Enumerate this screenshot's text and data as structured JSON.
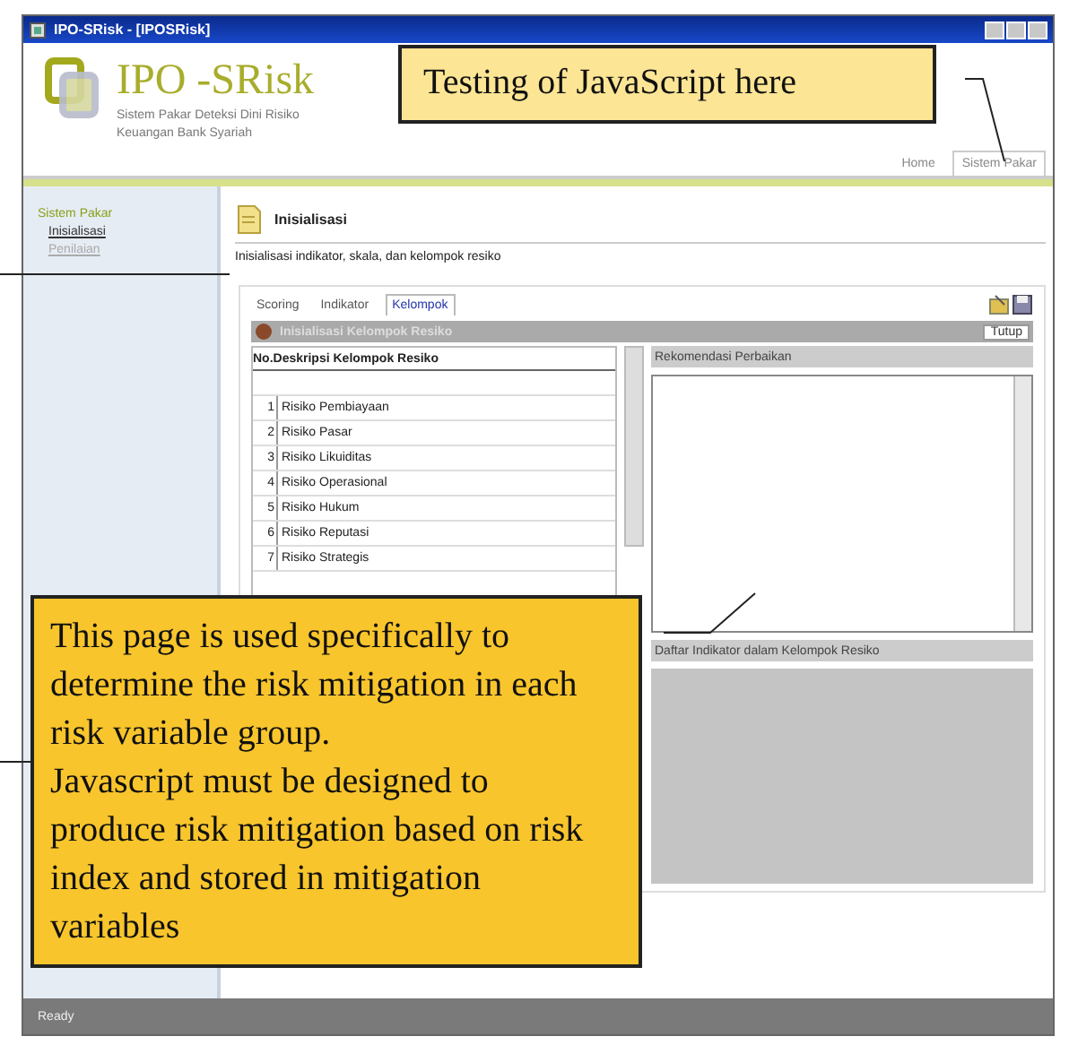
{
  "window": {
    "title": "IPO-SRisk - [IPOSRisk]"
  },
  "header": {
    "logo": "IPO -SRisk",
    "tagline": "Sistem Pakar Deteksi Dini Risiko Keuangan Bank Syariah",
    "nav": [
      {
        "label": "Home",
        "selected": false
      },
      {
        "label": "Sistem Pakar",
        "selected": true
      }
    ]
  },
  "sidebar": {
    "title": "Sistem Pakar",
    "items": [
      {
        "label": "Inisialisasi",
        "selected": true
      },
      {
        "label": "Penilaian",
        "selected": false
      }
    ]
  },
  "page": {
    "title": "Inisialisasi",
    "description": "Inisialisasi indikator, skala, dan kelompok resiko",
    "tabs": [
      {
        "label": "Scoring",
        "selected": false
      },
      {
        "label": "Indikator",
        "selected": false
      },
      {
        "label": "Kelompok",
        "selected": true
      }
    ],
    "panel": {
      "title": "Inisialisasi Kelompok Resiko",
      "button": "Tutup",
      "table": {
        "columns": [
          "No.",
          "Deskripsi Kelompok Resiko"
        ],
        "rows": [
          [
            "1",
            "Risiko Pembiayaan"
          ],
          [
            "2",
            "Risiko Pasar"
          ],
          [
            "3",
            "Risiko Likuiditas"
          ],
          [
            "4",
            "Risiko Operasional"
          ],
          [
            "5",
            "Risiko Hukum"
          ],
          [
            "6",
            "Risiko Reputasi"
          ],
          [
            "7",
            "Risiko Strategis"
          ]
        ]
      },
      "recommendation": {
        "title": "Rekomendasi Perbaikan"
      },
      "indicators": {
        "title": "Daftar Indikator dalam Kelompok Resiko"
      }
    }
  },
  "status_bar": {
    "text": "Ready"
  },
  "callouts": [
    {
      "text": "Testing of JavaScript here"
    },
    {
      "text": "This page is used specifically to determine the risk mitigation in each risk variable group.\nJavascript must be designed to produce risk mitigation based on risk index and stored in mitigation variables"
    }
  ]
}
